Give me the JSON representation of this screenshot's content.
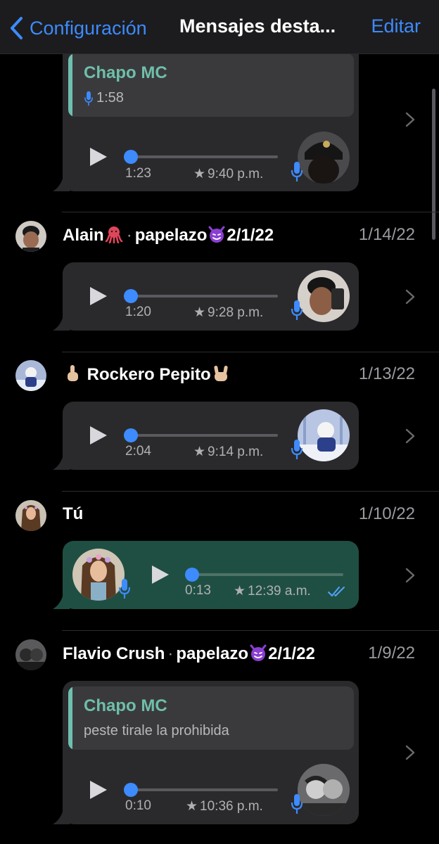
{
  "nav": {
    "back_label": "Configuración",
    "title": "Mensajes desta...",
    "edit_label": "Editar"
  },
  "colors": {
    "accent": "#3d8bfd",
    "bubble_received": "#2a2a2d",
    "bubble_sent": "#1f4f42",
    "quote_name": "#6fbfa8"
  },
  "messages": [
    {
      "quote": {
        "name": "Chapo MC",
        "sub": "1:58"
      },
      "duration": "1:23",
      "time": "9:40 p.m.",
      "avatar_icon": "dark-cap-avatar"
    },
    {
      "sender": "Alain",
      "group": "papelazo",
      "group_suffix": "2/1/22",
      "date": "1/14/22",
      "duration": "1:20",
      "time": "9:28 p.m.",
      "avatar_icon": "person-avatar"
    },
    {
      "sender": "Rockero Pepito",
      "date": "1/13/22",
      "duration": "2:04",
      "time": "9:14 p.m.",
      "avatar_icon": "winter-character-avatar"
    },
    {
      "sender": "Tú",
      "date": "1/10/22",
      "duration": "0:13",
      "time": "12:39 a.m.",
      "avatar_icon": "doll-avatar"
    },
    {
      "sender": "Flavio Crush",
      "group": "papelazo",
      "group_suffix": "2/1/22",
      "date": "1/9/22",
      "quote": {
        "name": "Chapo MC",
        "sub": "peste tirale la prohibida"
      },
      "duration": "0:10",
      "time": "10:36 p.m.",
      "avatar_icon": "two-people-avatar"
    }
  ]
}
